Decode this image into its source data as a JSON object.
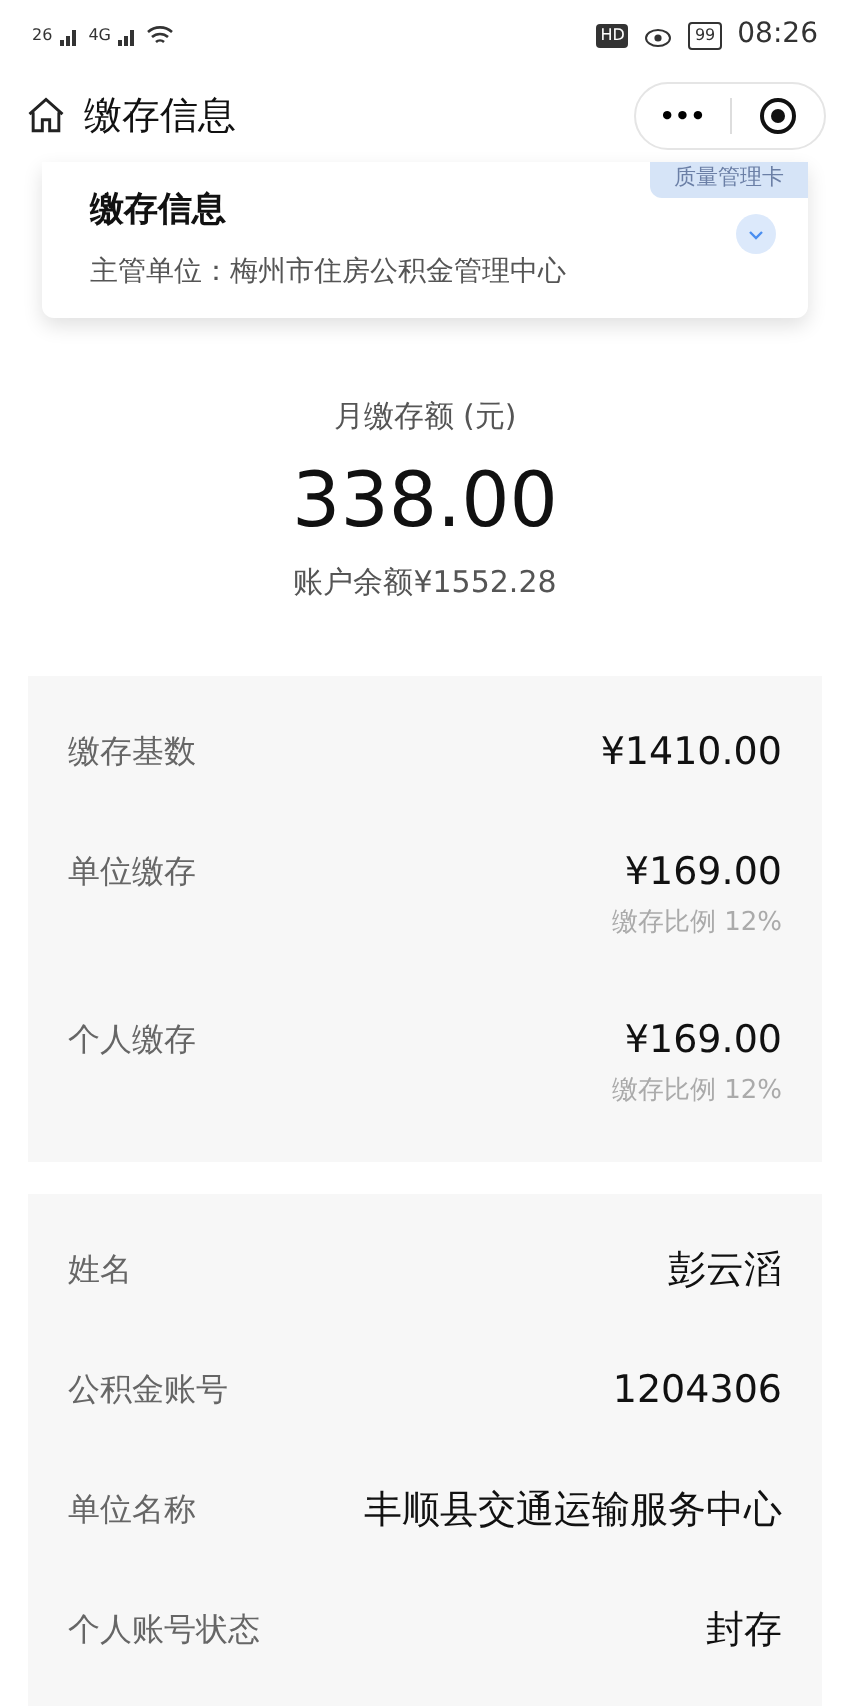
{
  "status_bar": {
    "sim1": "26",
    "sim2": "4G",
    "hd": "HD",
    "battery": "99",
    "time": "08:26"
  },
  "nav": {
    "title": "缴存信息",
    "more": "•••"
  },
  "card": {
    "title": "缴存信息",
    "subtitle": "主管单位：梅州市住房公积金管理中心",
    "badge": "质量管理卡",
    "expanded": false
  },
  "summary": {
    "label": "月缴存额 (元)",
    "amount": "338.00",
    "balance": "账户余额¥1552.28"
  },
  "deposit_rows": [
    {
      "label": "缴存基数",
      "value": "¥1410.00"
    },
    {
      "label": "单位缴存",
      "value": "¥169.00",
      "note": "缴存比例 12%"
    },
    {
      "label": "个人缴存",
      "value": "¥169.00",
      "note": "缴存比例 12%"
    }
  ],
  "info_rows": [
    {
      "label": "姓名",
      "value": "彭云滔"
    },
    {
      "label": "公积金账号",
      "value": "1204306"
    },
    {
      "label": "单位名称",
      "value": "丰顺县交通运输服务中心"
    },
    {
      "label": "个人账号状态",
      "value": "封存"
    }
  ]
}
